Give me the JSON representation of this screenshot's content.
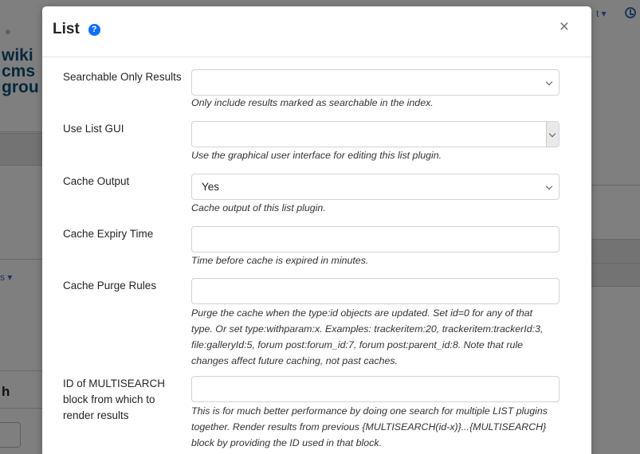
{
  "background": {
    "logo_lines": [
      "wiki",
      "cms",
      "grou"
    ],
    "registered_mark": "®",
    "left_dropdown_label": "s ▾",
    "search_heading": "h",
    "top_dropdown_label": "t ▾"
  },
  "modal": {
    "title": "List",
    "help_icon": "?",
    "close_label": "×",
    "fields": [
      {
        "label": "Searchable Only Results",
        "type": "select",
        "value": "",
        "help": "Only include results marked as searchable in the index."
      },
      {
        "label": "Use List GUI",
        "type": "select",
        "value": "",
        "help": "Use the graphical user interface for editing this list plugin."
      },
      {
        "label": "Cache Output",
        "type": "select",
        "value": "Yes",
        "help": "Cache output of this list plugin."
      },
      {
        "label": "Cache Expiry Time",
        "type": "text",
        "value": "",
        "help": "Time before cache is expired in minutes."
      },
      {
        "label": "Cache Purge Rules",
        "type": "text",
        "value": "",
        "help_lines": [
          "Purge the cache when the type:id objects are updated. Set id=0 for any of that",
          "type. Or set type:withparam:x. Examples: trackeritem:20, trackeritem:trackerId:3,",
          "file:galleryId:5, forum post:forum_id:7, forum post:parent_id:8. Note that rule",
          "changes affect future caching, not past caches."
        ]
      },
      {
        "label_lines": [
          "ID of MULTISEARCH",
          "block from which to",
          "render results"
        ],
        "type": "text",
        "value": "",
        "help_lines": [
          "This is for much better performance by doing one search for multiple LIST plugins",
          "together. Render results from previous {MULTISEARCH(id-x)}...{MULTISEARCH}",
          "block by providing the ID used in that block."
        ]
      }
    ]
  }
}
